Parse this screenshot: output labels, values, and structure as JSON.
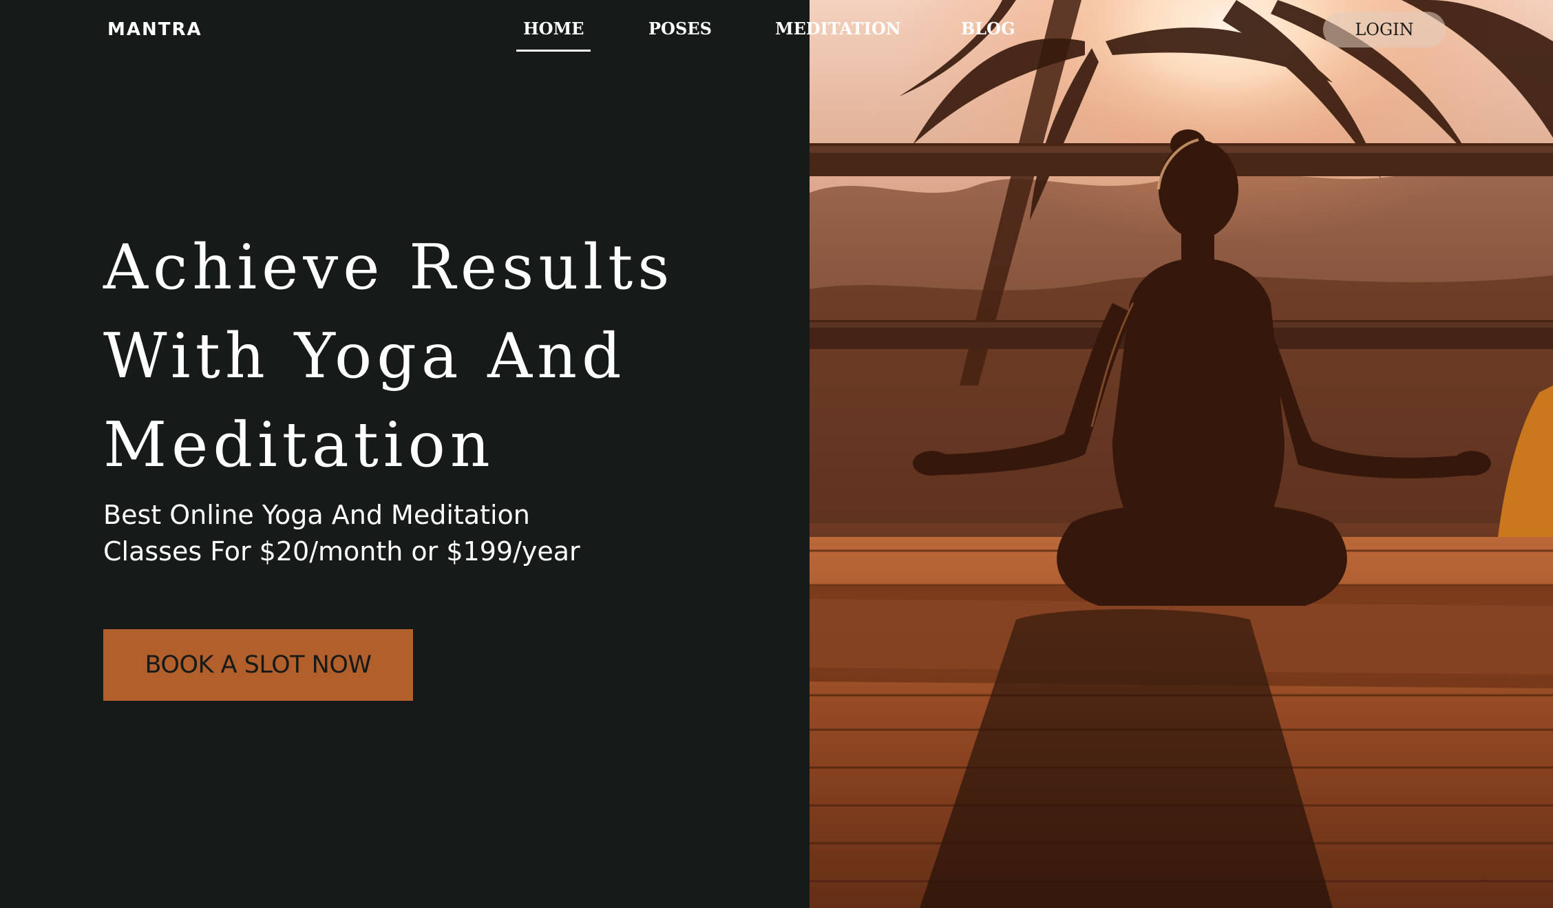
{
  "brand": {
    "logo_text": "MANTRA"
  },
  "nav": {
    "items": [
      {
        "label": "HOME",
        "active": true
      },
      {
        "label": "POSES",
        "active": false
      },
      {
        "label": "MEDITATION",
        "active": false
      },
      {
        "label": "BLOG",
        "active": false
      }
    ],
    "login_label": "LOGIN"
  },
  "hero": {
    "title": "Achieve Results With Yoga And Meditation",
    "subtitle": "Best Online Yoga And Meditation Classes For $20/month or $199/year",
    "cta_label": "BOOK A SLOT NOW",
    "image_icon": "person-meditating-silhouette-icon"
  },
  "colors": {
    "background": "#161a18",
    "accent": "#b35f2b",
    "text": "#ffffff"
  }
}
